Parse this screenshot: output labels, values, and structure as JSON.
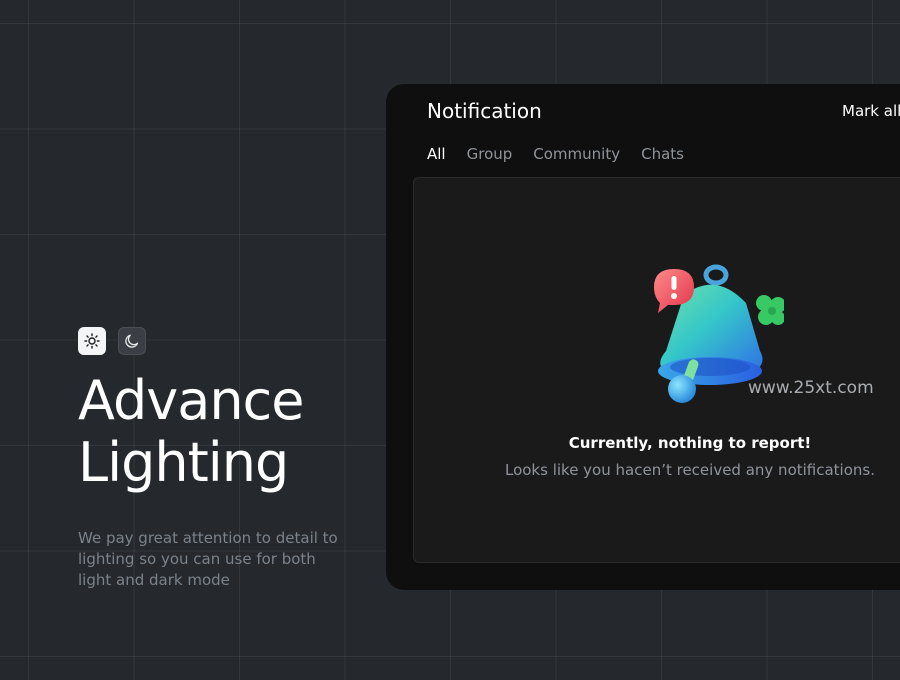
{
  "hero": {
    "title_line1": "Advance",
    "title_line2": "Lighting",
    "description": "We pay great attention to detail to lighting so you can use for both light and dark mode",
    "modes": [
      {
        "icon": "sun-icon",
        "active": true
      },
      {
        "icon": "moon-icon",
        "active": false
      }
    ]
  },
  "panel": {
    "title": "Notification",
    "mark_all": "Mark all",
    "tabs": [
      {
        "label": "All",
        "active": true
      },
      {
        "label": "Group",
        "active": false
      },
      {
        "label": "Community",
        "active": false
      },
      {
        "label": "Chats",
        "active": false
      }
    ],
    "empty": {
      "illustration": "bell-icon",
      "watermark": "www.25xt.com",
      "title": "Currently, nothing to report!",
      "subtitle": "Looks like you hacen’t received any notifications."
    }
  },
  "colors": {
    "background": "#25292d",
    "panel": "#0f0f10",
    "content": "#1a1a1b",
    "text_primary": "#ffffff",
    "text_muted": "#8f949a"
  }
}
